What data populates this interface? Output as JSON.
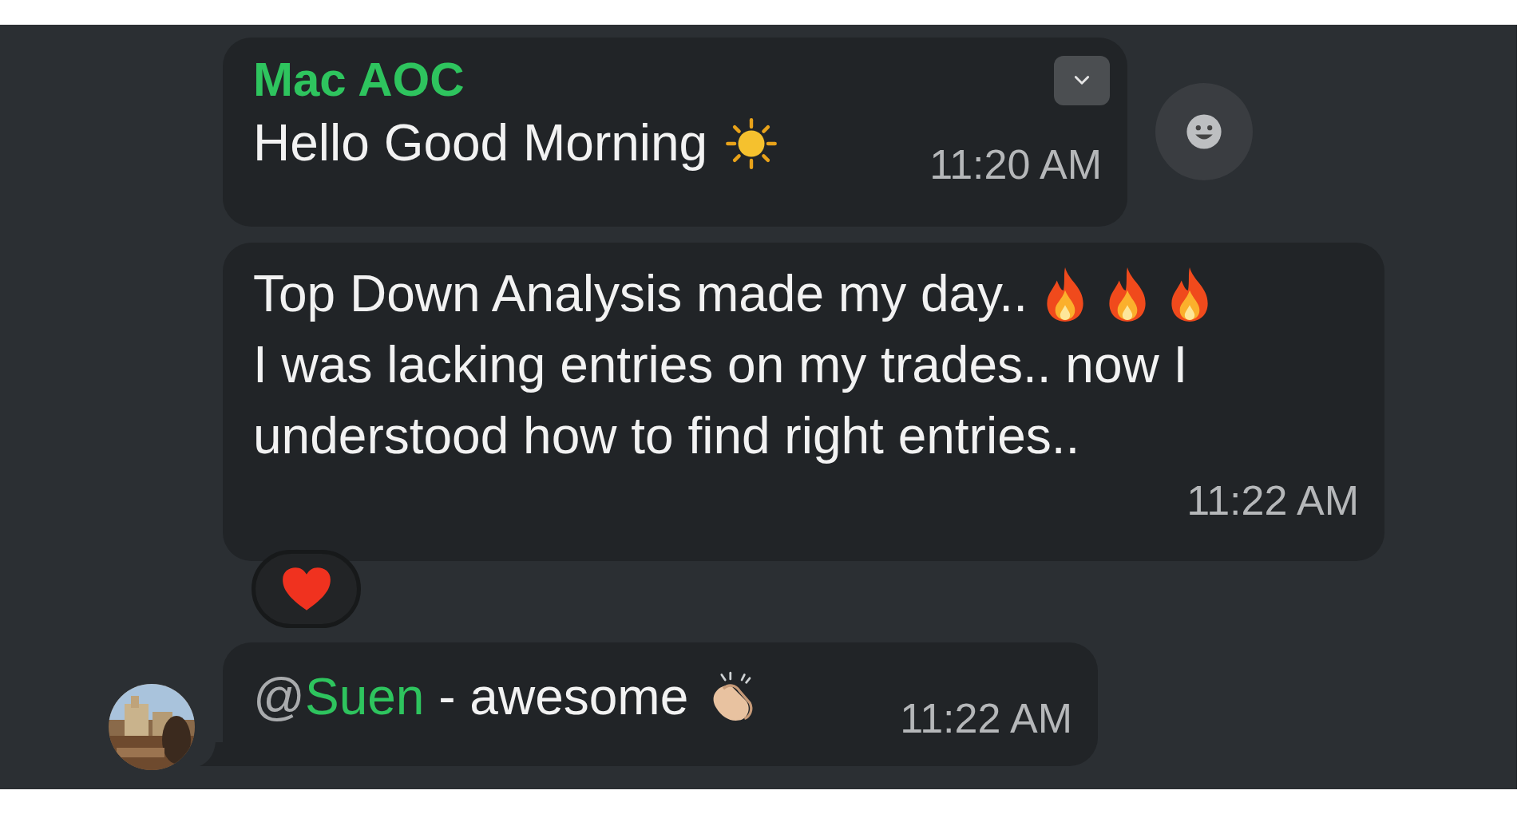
{
  "messages": [
    {
      "kind": "first",
      "sender": "Mac AOC",
      "lines": [
        {
          "text": "Hello Good Morning",
          "icons": [
            {
              "kind": "sun"
            }
          ]
        }
      ],
      "time": "11:20 AM",
      "menu_button": true,
      "react_button": true
    },
    {
      "kind": "plain",
      "lines": [
        {
          "text": "Top Down Analysis made my day..",
          "icons": [
            {
              "kind": "fire"
            },
            {
              "kind": "fire"
            },
            {
              "kind": "fire"
            }
          ]
        },
        {
          "text": "I was lacking entries on my trades.. now I"
        },
        {
          "text": "understood how to find right entries.."
        }
      ],
      "time": "11:22 AM",
      "reactions": [
        {
          "kind": "heart"
        }
      ]
    },
    {
      "kind": "last",
      "mention": {
        "at": "@",
        "name": "Suen"
      },
      "lines": [
        {
          "text": " - awesome",
          "icons": [
            {
              "kind": "clap"
            }
          ]
        }
      ],
      "time": "11:22 AM"
    }
  ]
}
